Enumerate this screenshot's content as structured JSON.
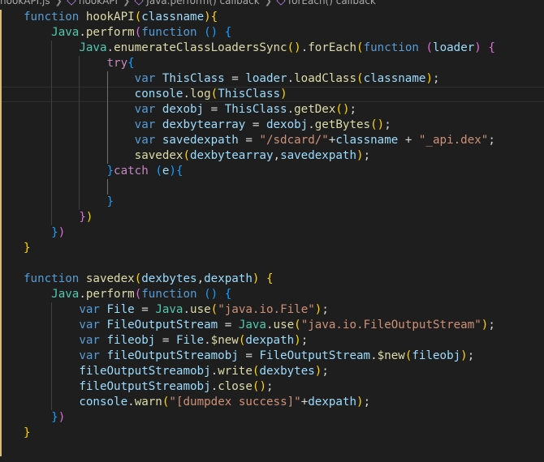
{
  "breadcrumb": {
    "file": "hookAPI.js",
    "items": [
      "hookAPI",
      "Java.perform() callback",
      "forEach() callback"
    ]
  },
  "code": {
    "lines": [
      [
        [
          "kw",
          "function"
        ],
        [
          "pl",
          " "
        ],
        [
          "fn",
          "hookAPI"
        ],
        [
          "p0",
          "("
        ],
        [
          "var",
          "classname"
        ],
        [
          "p0",
          ")"
        ],
        [
          "p0",
          "{"
        ]
      ],
      [
        [
          "pl",
          "    "
        ],
        [
          "cls",
          "Java"
        ],
        [
          "pl",
          "."
        ],
        [
          "fn",
          "perform"
        ],
        [
          "p1",
          "("
        ],
        [
          "kw",
          "function"
        ],
        [
          "pl",
          " "
        ],
        [
          "p2",
          "("
        ],
        [
          "p2",
          ")"
        ],
        [
          "pl",
          " "
        ],
        [
          "p2",
          "{"
        ]
      ],
      [
        [
          "pl",
          "        "
        ],
        [
          "cls",
          "Java"
        ],
        [
          "pl",
          "."
        ],
        [
          "fn",
          "enumerateClassLoadersSync"
        ],
        [
          "p0",
          "("
        ],
        [
          "p0",
          ")"
        ],
        [
          "pl",
          "."
        ],
        [
          "fn",
          "forEach"
        ],
        [
          "p0",
          "("
        ],
        [
          "kw",
          "function"
        ],
        [
          "pl",
          " "
        ],
        [
          "p1",
          "("
        ],
        [
          "var",
          "loader"
        ],
        [
          "p1",
          ")"
        ],
        [
          "pl",
          " "
        ],
        [
          "p1",
          "{"
        ]
      ],
      [
        [
          "pl",
          "            "
        ],
        [
          "ctl",
          "try"
        ],
        [
          "p2",
          "{"
        ]
      ],
      [
        [
          "pl",
          "                "
        ],
        [
          "kw",
          "var"
        ],
        [
          "pl",
          " "
        ],
        [
          "var",
          "ThisClass"
        ],
        [
          "pl",
          " = "
        ],
        [
          "var",
          "loader"
        ],
        [
          "pl",
          "."
        ],
        [
          "fn",
          "loadClass"
        ],
        [
          "p0",
          "("
        ],
        [
          "var",
          "classname"
        ],
        [
          "p0",
          ")"
        ],
        [
          "pl",
          ";"
        ]
      ],
      [
        [
          "pl",
          "                "
        ],
        [
          "var",
          "console"
        ],
        [
          "pl",
          "."
        ],
        [
          "fn",
          "log"
        ],
        [
          "p0",
          "("
        ],
        [
          "var",
          "ThisClass"
        ],
        [
          "p0",
          ")"
        ]
      ],
      [
        [
          "pl",
          "                "
        ],
        [
          "kw",
          "var"
        ],
        [
          "pl",
          " "
        ],
        [
          "var",
          "dexobj"
        ],
        [
          "pl",
          " = "
        ],
        [
          "var",
          "ThisClass"
        ],
        [
          "pl",
          "."
        ],
        [
          "fn",
          "getDex"
        ],
        [
          "p0",
          "("
        ],
        [
          "p0",
          ")"
        ],
        [
          "pl",
          ";"
        ]
      ],
      [
        [
          "pl",
          "                "
        ],
        [
          "kw",
          "var"
        ],
        [
          "pl",
          " "
        ],
        [
          "var",
          "dexbytearray"
        ],
        [
          "pl",
          " = "
        ],
        [
          "var",
          "dexobj"
        ],
        [
          "pl",
          "."
        ],
        [
          "fn",
          "getBytes"
        ],
        [
          "p0",
          "("
        ],
        [
          "p0",
          ")"
        ],
        [
          "pl",
          ";"
        ]
      ],
      [
        [
          "pl",
          "                "
        ],
        [
          "kw",
          "var"
        ],
        [
          "pl",
          " "
        ],
        [
          "var",
          "savedexpath"
        ],
        [
          "pl",
          " = "
        ],
        [
          "str",
          "\"/sdcard/\""
        ],
        [
          "pl",
          "+"
        ],
        [
          "var",
          "classname"
        ],
        [
          "pl",
          " + "
        ],
        [
          "str",
          "\"_api.dex\""
        ],
        [
          "pl",
          ";"
        ]
      ],
      [
        [
          "pl",
          "                "
        ],
        [
          "fn",
          "savedex"
        ],
        [
          "p0",
          "("
        ],
        [
          "var",
          "dexbytearray"
        ],
        [
          "pl",
          ","
        ],
        [
          "var",
          "savedexpath"
        ],
        [
          "p0",
          ")"
        ],
        [
          "pl",
          ";"
        ]
      ],
      [
        [
          "pl",
          "            "
        ],
        [
          "p2",
          "}"
        ],
        [
          "ctl",
          "catch"
        ],
        [
          "pl",
          " "
        ],
        [
          "p2",
          "("
        ],
        [
          "var",
          "e"
        ],
        [
          "p2",
          ")"
        ],
        [
          "p2",
          "{"
        ]
      ],
      [
        [
          "pl",
          ""
        ]
      ],
      [
        [
          "pl",
          "            "
        ],
        [
          "p2",
          "}"
        ]
      ],
      [
        [
          "pl",
          "        "
        ],
        [
          "p1",
          "}"
        ],
        [
          "p0",
          ")"
        ]
      ],
      [
        [
          "pl",
          "    "
        ],
        [
          "p2",
          "}"
        ],
        [
          "p1",
          ")"
        ]
      ],
      [
        [
          "p0",
          "}"
        ]
      ],
      [
        [
          "pl",
          ""
        ]
      ],
      [
        [
          "kw",
          "function"
        ],
        [
          "pl",
          " "
        ],
        [
          "fn",
          "savedex"
        ],
        [
          "p0",
          "("
        ],
        [
          "var",
          "dexbytes"
        ],
        [
          "pl",
          ","
        ],
        [
          "var",
          "dexpath"
        ],
        [
          "p0",
          ")"
        ],
        [
          "pl",
          " "
        ],
        [
          "p0",
          "{"
        ]
      ],
      [
        [
          "pl",
          "    "
        ],
        [
          "cls",
          "Java"
        ],
        [
          "pl",
          "."
        ],
        [
          "fn",
          "perform"
        ],
        [
          "p1",
          "("
        ],
        [
          "kw",
          "function"
        ],
        [
          "pl",
          " "
        ],
        [
          "p2",
          "("
        ],
        [
          "p2",
          ")"
        ],
        [
          "pl",
          " "
        ],
        [
          "p2",
          "{"
        ]
      ],
      [
        [
          "pl",
          "        "
        ],
        [
          "kw",
          "var"
        ],
        [
          "pl",
          " "
        ],
        [
          "var",
          "File"
        ],
        [
          "pl",
          " = "
        ],
        [
          "cls",
          "Java"
        ],
        [
          "pl",
          "."
        ],
        [
          "fn",
          "use"
        ],
        [
          "p0",
          "("
        ],
        [
          "str",
          "\"java.io.File\""
        ],
        [
          "p0",
          ")"
        ],
        [
          "pl",
          ";"
        ]
      ],
      [
        [
          "pl",
          "        "
        ],
        [
          "kw",
          "var"
        ],
        [
          "pl",
          " "
        ],
        [
          "var",
          "FileOutputStream"
        ],
        [
          "pl",
          " = "
        ],
        [
          "cls",
          "Java"
        ],
        [
          "pl",
          "."
        ],
        [
          "fn",
          "use"
        ],
        [
          "p0",
          "("
        ],
        [
          "str",
          "\"java.io.FileOutputStream\""
        ],
        [
          "p0",
          ")"
        ],
        [
          "pl",
          ";"
        ]
      ],
      [
        [
          "pl",
          "        "
        ],
        [
          "kw",
          "var"
        ],
        [
          "pl",
          " "
        ],
        [
          "var",
          "fileobj"
        ],
        [
          "pl",
          " = "
        ],
        [
          "var",
          "File"
        ],
        [
          "pl",
          "."
        ],
        [
          "fn",
          "$new"
        ],
        [
          "p0",
          "("
        ],
        [
          "var",
          "dexpath"
        ],
        [
          "p0",
          ")"
        ],
        [
          "pl",
          ";"
        ]
      ],
      [
        [
          "pl",
          "        "
        ],
        [
          "kw",
          "var"
        ],
        [
          "pl",
          " "
        ],
        [
          "var",
          "fileOutputStreamobj"
        ],
        [
          "pl",
          " = "
        ],
        [
          "var",
          "FileOutputStream"
        ],
        [
          "pl",
          "."
        ],
        [
          "fn",
          "$new"
        ],
        [
          "p0",
          "("
        ],
        [
          "var",
          "fileobj"
        ],
        [
          "p0",
          ")"
        ],
        [
          "pl",
          ";"
        ]
      ],
      [
        [
          "pl",
          "        "
        ],
        [
          "var",
          "fileOutputStreamobj"
        ],
        [
          "pl",
          "."
        ],
        [
          "fn",
          "write"
        ],
        [
          "p0",
          "("
        ],
        [
          "var",
          "dexbytes"
        ],
        [
          "p0",
          ")"
        ],
        [
          "pl",
          ";"
        ]
      ],
      [
        [
          "pl",
          "        "
        ],
        [
          "var",
          "fileOutputStreamobj"
        ],
        [
          "pl",
          "."
        ],
        [
          "fn",
          "close"
        ],
        [
          "p0",
          "("
        ],
        [
          "p0",
          ")"
        ],
        [
          "pl",
          ";"
        ]
      ],
      [
        [
          "pl",
          "        "
        ],
        [
          "var",
          "console"
        ],
        [
          "pl",
          "."
        ],
        [
          "fn",
          "warn"
        ],
        [
          "p0",
          "("
        ],
        [
          "str",
          "\"[dumpdex success]\""
        ],
        [
          "pl",
          "+"
        ],
        [
          "var",
          "dexpath"
        ],
        [
          "p0",
          ")"
        ],
        [
          "pl",
          ";"
        ]
      ],
      [
        [
          "pl",
          "    "
        ],
        [
          "p2",
          "}"
        ],
        [
          "p1",
          ")"
        ]
      ],
      [
        [
          "p0",
          "}"
        ]
      ],
      [
        [
          "pl",
          ""
        ]
      ]
    ],
    "current_line": 5
  }
}
